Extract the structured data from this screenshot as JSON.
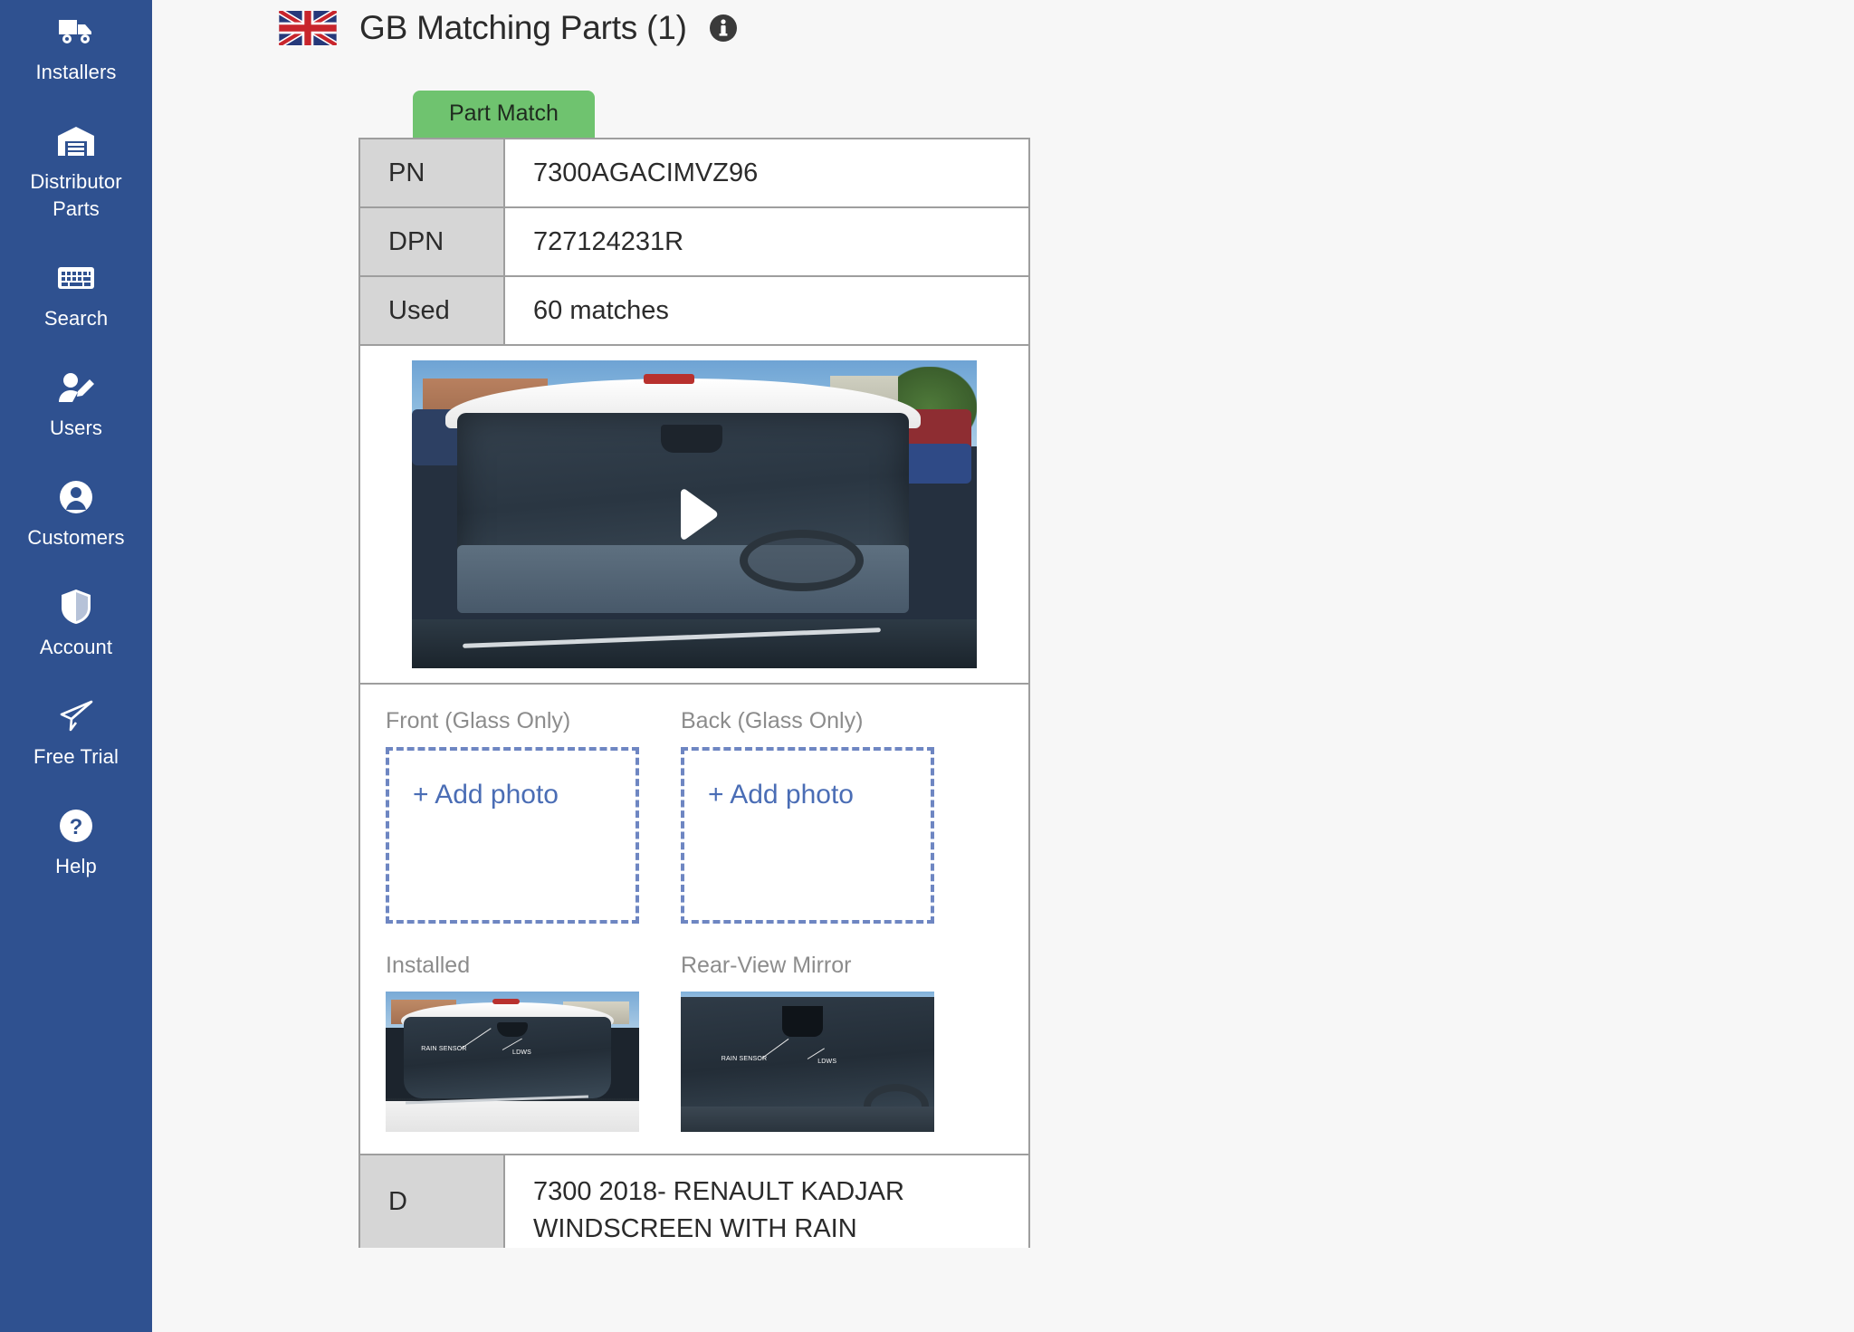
{
  "sidebar": {
    "items": [
      {
        "label": "Installers",
        "icon": "truck-icon"
      },
      {
        "label": "Distributor Parts",
        "icon": "warehouse-icon"
      },
      {
        "label": "Search",
        "icon": "keyboard-icon"
      },
      {
        "label": "Users",
        "icon": "user-edit-icon"
      },
      {
        "label": "Customers",
        "icon": "user-circle-icon"
      },
      {
        "label": "Account",
        "icon": "shield-icon"
      },
      {
        "label": "Free Trial",
        "icon": "paper-plane-icon"
      },
      {
        "label": "Help",
        "icon": "question-circle-icon"
      }
    ]
  },
  "header": {
    "flag": "gb-flag-icon",
    "title": "GB Matching Parts (1)",
    "info_icon": "info-icon"
  },
  "tabs": [
    {
      "label": "Part Match",
      "active": true
    }
  ],
  "detail": {
    "rows": [
      {
        "label": "PN",
        "value": "7300AGACIMVZ96"
      },
      {
        "label": "DPN",
        "value": "727124231R"
      },
      {
        "label": "Used",
        "value": "60 matches"
      }
    ],
    "video": {
      "play_icon": "play-icon",
      "alt": "Vehicle windscreen video"
    },
    "photos": [
      {
        "caption": "Front (Glass Only)",
        "action_label": "+ Add photo",
        "has_image": false
      },
      {
        "caption": "Back (Glass Only)",
        "action_label": "+ Add photo",
        "has_image": false
      },
      {
        "caption": "Installed",
        "has_image": true,
        "annotations": [
          "RAIN SENSOR",
          "LDWS"
        ]
      },
      {
        "caption": "Rear-View Mirror",
        "has_image": true,
        "annotations": [
          "RAIN SENSOR",
          "LDWS"
        ]
      }
    ],
    "description": {
      "label": "D",
      "value": "7300 2018- RENAULT KADJAR WINDSCREEN WITH RAIN"
    }
  },
  "colors": {
    "sidebar_bg": "#2f5190",
    "page_bg": "#f7f7f7",
    "tab_green": "#6fc36f",
    "label_cell_bg": "#d6d6d6",
    "border_gray": "#9e9e9e",
    "dashed_blue": "#6e86c2",
    "link_blue": "#4a6db5",
    "caption_gray": "#8c8c8c"
  }
}
